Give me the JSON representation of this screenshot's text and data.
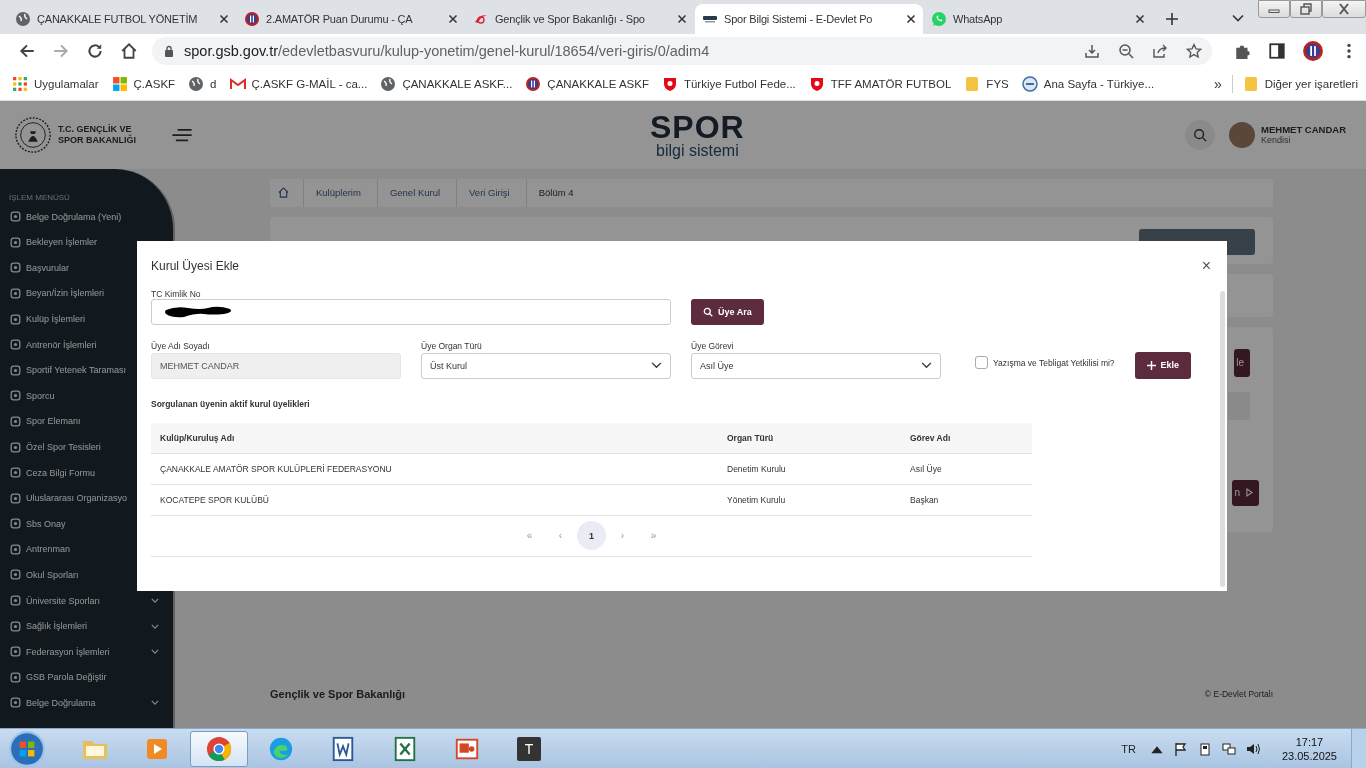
{
  "browser": {
    "tabs": [
      {
        "title": "ÇANAKKALE FUTBOL YÖNETİM",
        "kind": "globe",
        "selected": false
      },
      {
        "title": "2.AMATÖR Puan Durumu - ÇA",
        "kind": "crest",
        "selected": false
      },
      {
        "title": "Gençlik ve Spor Bakanlığı - Spo",
        "kind": "swoosh",
        "selected": false
      },
      {
        "title": "Spor Bilgi Sistemi - E-Devlet Po",
        "kind": "spor",
        "selected": true
      },
      {
        "title": "WhatsApp",
        "kind": "whatsapp",
        "selected": false
      }
    ],
    "url_host": "spor.gsb.gov.tr",
    "url_path": "/edevletbasvuru/kulup-yonetim/genel-kurul/18654/veri-giris/0/adim4",
    "bookmarks": [
      {
        "label": "Uygulamalar",
        "kind": "apps"
      },
      {
        "label": "Ç.ASKF",
        "kind": "windows"
      },
      {
        "label": "d",
        "kind": "globe"
      },
      {
        "label": "Ç.ASKF G-MAİL - ca...",
        "kind": "gmail"
      },
      {
        "label": "ÇANAKKALE ASKF...",
        "kind": "globe"
      },
      {
        "label": "ÇANAKKALE ASKF",
        "kind": "crest"
      },
      {
        "label": "Türkiye Futbol Fede...",
        "kind": "tff"
      },
      {
        "label": "TFF AMATÖR FUTBOL",
        "kind": "tff"
      },
      {
        "label": "FYS",
        "kind": "folder"
      },
      {
        "label": "Ana Sayfa - Türkiye...",
        "kind": "seal"
      }
    ],
    "more": "»",
    "other_bookmarks": "Diğer yer işaretleri"
  },
  "header": {
    "ministry_line1": "T.C. GENÇLİK VE",
    "ministry_line2": "SPOR BAKANLIĞI",
    "logo_word": "SPOR",
    "logo_sub": "bilgi sistemi",
    "user_name": "MEHMET CANDAR",
    "user_role": "Kendisi"
  },
  "sidebar": {
    "title": "İŞLEM MENÜSÜ",
    "items": [
      {
        "label": "Belge Doğrulama (Yeni)",
        "expandable": false
      },
      {
        "label": "Bekleyen İşlemler",
        "expandable": false
      },
      {
        "label": "Başvurular",
        "expandable": false
      },
      {
        "label": "Beyan/İzin İşlemleri",
        "expandable": false
      },
      {
        "label": "Kulüp İşlemleri",
        "expandable": false
      },
      {
        "label": "Antrenör İşlemleri",
        "expandable": false
      },
      {
        "label": "Sportif Yetenek Taraması",
        "expandable": false
      },
      {
        "label": "Sporcu",
        "expandable": false
      },
      {
        "label": "Spor Elemanı",
        "expandable": false
      },
      {
        "label": "Özel Spor Tesisleri",
        "expandable": false
      },
      {
        "label": "Ceza Bilgi Formu",
        "expandable": false
      },
      {
        "label": "Uluslararası Organizasyo",
        "expandable": false
      },
      {
        "label": "Sbs Onay",
        "expandable": false
      },
      {
        "label": "Antrenman",
        "expandable": false
      },
      {
        "label": "Okul Sporları",
        "expandable": false
      },
      {
        "label": "Üniversite Sporları",
        "expandable": true
      },
      {
        "label": "Sağlık İşlemleri",
        "expandable": true
      },
      {
        "label": "Federasyon İşlemleri",
        "expandable": true
      },
      {
        "label": "GSB Parola Değiştir",
        "expandable": false
      },
      {
        "label": "Belge Doğrulama",
        "expandable": true
      }
    ]
  },
  "breadcrumb": [
    "Kulüplerim",
    "Genel Kurul",
    "Veri Girişi",
    "Bölüm 4"
  ],
  "background_buttons": [
    {
      "label": "le"
    },
    {
      "label": "n"
    }
  ],
  "footer": {
    "left": "Gençlik ve Spor Bakanlığı",
    "right": "© E-Devlet Portalı"
  },
  "modal": {
    "title": "Kurul Üyesi Ekle",
    "close": "×",
    "tc_field": {
      "label": "TC Kimlik No"
    },
    "search_button": "Üye Ara",
    "name_field": {
      "label": "Üye Adı Soyadı",
      "value": "MEHMET CANDAR",
      "disabled": true
    },
    "organ_select": {
      "label": "Üye Organ Türü",
      "value": "Üst Kurul"
    },
    "role_select": {
      "label": "Üye Görevi",
      "value": "Asıl Üye"
    },
    "checkbox": {
      "label": "Yazışma ve Tebligat Yetkilisi mi?",
      "checked": false
    },
    "add_button": "Ekle",
    "table_title": "Sorgulanan üyenin aktif kurul üyelikleri",
    "columns": [
      "Kulüp/Kuruluş Adı",
      "Organ Türü",
      "Görev Adı"
    ],
    "rows": [
      [
        "ÇANAKKALE AMATÖR SPOR KULÜPLERİ FEDERASYONU",
        "Denetim Kurulu",
        "Asıl Üye"
      ],
      [
        "KOCATEPE SPOR KULÜBÜ",
        "Yönetim Kurulu",
        "Başkan"
      ]
    ],
    "pagination": [
      {
        "label": "«",
        "selected": false
      },
      {
        "label": "‹",
        "selected": false
      },
      {
        "label": "1",
        "selected": true
      },
      {
        "label": "›",
        "selected": false
      },
      {
        "label": "»",
        "selected": false
      }
    ]
  },
  "taskbar": {
    "apps": [
      {
        "kind": "explorer",
        "selected": false
      },
      {
        "kind": "media",
        "selected": false
      },
      {
        "kind": "chrome",
        "selected": true
      },
      {
        "kind": "edge",
        "selected": false
      },
      {
        "kind": "word",
        "selected": false
      },
      {
        "kind": "excel",
        "selected": false
      },
      {
        "kind": "slides",
        "selected": false
      },
      {
        "kind": "text",
        "label": "T",
        "selected": false
      }
    ],
    "language": "TR",
    "time": "17:17",
    "date": "23.05.2025"
  }
}
